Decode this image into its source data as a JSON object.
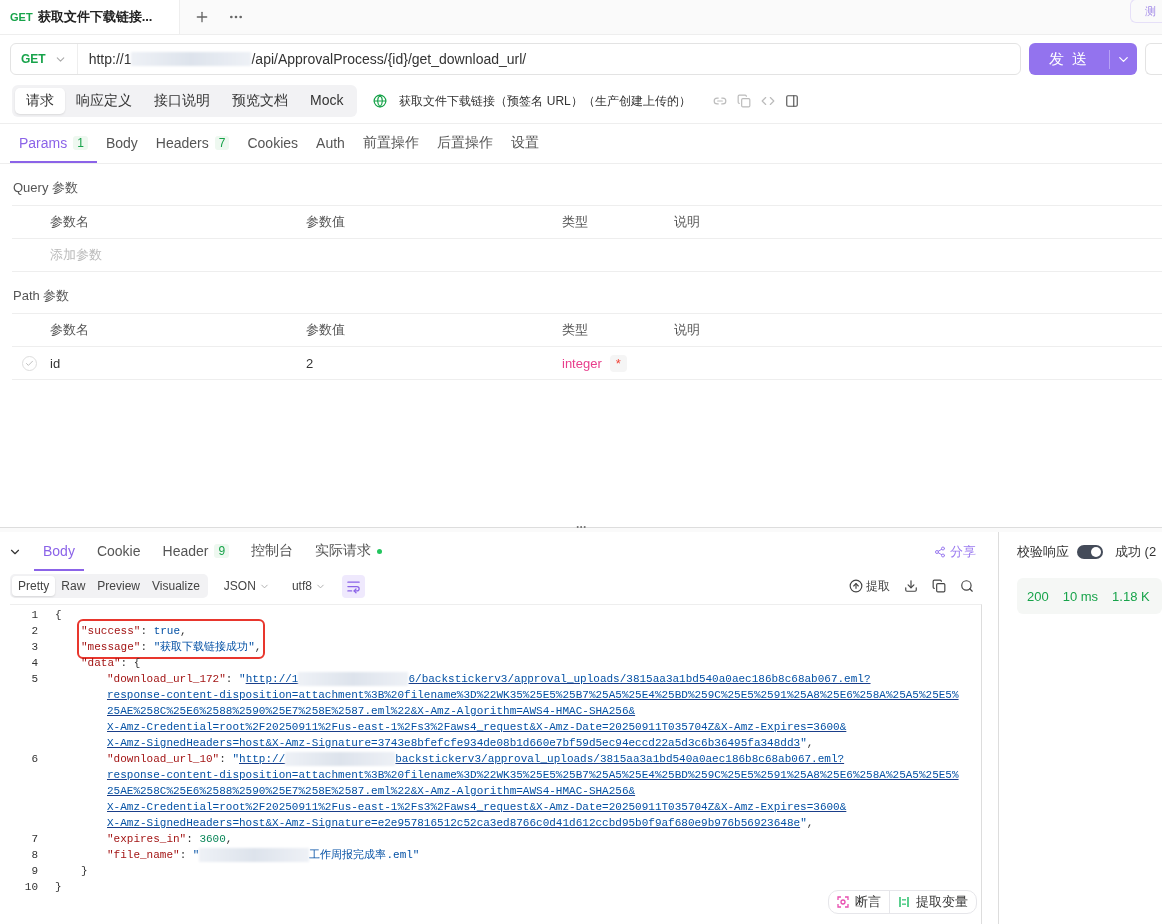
{
  "request_tab": {
    "method": "GET",
    "title": "获取文件下载链接..."
  },
  "corner_tab": "测",
  "url_bar": {
    "method": "GET",
    "url_prefix": "http://1",
    "url_suffix": "/api/ApprovalProcess/{id}/get_download_url/",
    "send": "发 送"
  },
  "request_tabs": [
    {
      "label": "请求",
      "selected": true
    },
    {
      "label": "响应定义",
      "selected": false
    },
    {
      "label": "接口说明",
      "selected": false
    },
    {
      "label": "预览文档",
      "selected": false
    },
    {
      "label": "Mock",
      "selected": false
    }
  ],
  "api_name": "获取文件下载链接（预签名 URL）（生产创建上传的）",
  "param_tabs": [
    {
      "label": "Params",
      "count": "1",
      "selected": true
    },
    {
      "label": "Body",
      "selected": false
    },
    {
      "label": "Headers",
      "count": "7",
      "selected": false
    },
    {
      "label": "Cookies",
      "selected": false
    },
    {
      "label": "Auth",
      "selected": false
    },
    {
      "label": "前置操作",
      "selected": false
    },
    {
      "label": "后置操作",
      "selected": false
    },
    {
      "label": "设置",
      "selected": false
    }
  ],
  "query": {
    "title": "Query 参数",
    "columns": [
      "参数名",
      "参数值",
      "类型",
      "说明"
    ],
    "placeholder": "添加参数"
  },
  "path": {
    "title": "Path 参数",
    "columns": [
      "参数名",
      "参数值",
      "类型",
      "说明"
    ],
    "rows": [
      {
        "checked": true,
        "name": "id",
        "value": "2",
        "type": "integer",
        "required": "*"
      }
    ]
  },
  "response": {
    "tabs": [
      {
        "label": "Body",
        "selected": true
      },
      {
        "label": "Cookie",
        "selected": false
      },
      {
        "label": "Header",
        "count": "9",
        "selected": false
      },
      {
        "label": "控制台",
        "selected": false
      },
      {
        "label": "实际请求",
        "dot": true,
        "selected": false
      }
    ],
    "share": "分享",
    "view_modes": [
      {
        "label": "Pretty",
        "selected": true
      },
      {
        "label": "Raw",
        "selected": false
      },
      {
        "label": "Preview",
        "selected": false
      },
      {
        "label": "Visualize",
        "selected": false
      }
    ],
    "format": "JSON",
    "encoding": "utf8",
    "extract": "提取",
    "lines": [
      {
        "n": "1",
        "tokens": [
          {
            "kind": "open",
            "text": "{"
          }
        ]
      },
      {
        "n": "2",
        "highlighted": true,
        "tokens": [
          {
            "kind": "key",
            "text": "\"success\""
          },
          {
            "kind": "punct",
            "text": ": "
          },
          {
            "kind": "bool",
            "text": "true"
          },
          {
            "kind": "punct",
            "text": ","
          }
        ]
      },
      {
        "n": "3",
        "highlighted": true,
        "tokens": [
          {
            "kind": "key",
            "text": "\"message\""
          },
          {
            "kind": "punct",
            "text": ": "
          },
          {
            "kind": "string",
            "text": "\"获取下载链接成功\""
          },
          {
            "kind": "punct",
            "text": ","
          }
        ]
      },
      {
        "n": "4",
        "highlighted": false,
        "tokens": [
          {
            "kind": "key",
            "text": "\"data\""
          },
          {
            "kind": "punct",
            "text": ": "
          },
          {
            "kind": "open",
            "text": "{"
          }
        ]
      },
      {
        "n": "5",
        "tokens": [
          {
            "kind": "key",
            "text": "\"download_url_172\""
          },
          {
            "kind": "punct",
            "text": ": "
          },
          {
            "kind": "string",
            "text": "\""
          },
          {
            "kind": "link",
            "text": "http://1"
          },
          {
            "kind": "redacted"
          },
          {
            "kind": "link",
            "text": "6/backstickerv3/approval_uploads/3815aa3a1bd540a0aec186b8c68ab067.eml?"
          },
          {
            "kind": "break"
          },
          {
            "kind": "link",
            "text": "response-content-disposition=attachment%3B%20filename%3D%22WK35%25E5%25B7%25A5%25E4%25BD%259C%25E5%2591%25A8%25E6%258A%25A5%25E5%"
          },
          {
            "kind": "break"
          },
          {
            "kind": "link",
            "text": "25AE%258C%25E6%2588%2590%25E7%258E%2587.eml%22&X-Amz-Algorithm=AWS4-HMAC-SHA256&"
          },
          {
            "kind": "break"
          },
          {
            "kind": "link",
            "text": "X-Amz-Credential=root%2F20250911%2Fus-east-1%2Fs3%2Faws4_request&X-Amz-Date=20250911T035704Z&X-Amz-Expires=3600&"
          },
          {
            "kind": "break"
          },
          {
            "kind": "link",
            "text": "X-Amz-SignedHeaders=host&X-Amz-Signature=3743e8bfefcfe934de08b1d660e7bf59d5ec94eccd22a5d3c6b36495fa348dd3"
          },
          {
            "kind": "string",
            "text": "\""
          },
          {
            "kind": "punct",
            "text": ","
          }
        ]
      },
      {
        "n": "6",
        "tokens": [
          {
            "kind": "key",
            "text": "\"download_url_10\""
          },
          {
            "kind": "punct",
            "text": ": "
          },
          {
            "kind": "string",
            "text": "\""
          },
          {
            "kind": "link",
            "text": "http://"
          },
          {
            "kind": "redacted"
          },
          {
            "kind": "link",
            "text": "backstickerv3/approval_uploads/3815aa3a1bd540a0aec186b8c68ab067.eml?"
          },
          {
            "kind": "break"
          },
          {
            "kind": "link",
            "text": "response-content-disposition=attachment%3B%20filename%3D%22WK35%25E5%25B7%25A5%25E4%25BD%259C%25E5%2591%25A8%25E6%258A%25A5%25E5%"
          },
          {
            "kind": "break"
          },
          {
            "kind": "link",
            "text": "25AE%258C%25E6%2588%2590%25E7%258E%2587.eml%22&X-Amz-Algorithm=AWS4-HMAC-SHA256&"
          },
          {
            "kind": "break"
          },
          {
            "kind": "link",
            "text": "X-Amz-Credential=root%2F20250911%2Fus-east-1%2Fs3%2Faws4_request&X-Amz-Date=20250911T035704Z&X-Amz-Expires=3600&"
          },
          {
            "kind": "break"
          },
          {
            "kind": "link",
            "text": "X-Amz-SignedHeaders=host&X-Amz-Signature=e2e957816512c52ca3ed8766c0d41d612ccbd95b0f9af680e9b976b56923648e"
          },
          {
            "kind": "string",
            "text": "\""
          },
          {
            "kind": "punct",
            "text": ","
          }
        ]
      },
      {
        "n": "7",
        "tokens": [
          {
            "kind": "key",
            "text": "\"expires_in\""
          },
          {
            "kind": "punct",
            "text": ": "
          },
          {
            "kind": "number",
            "text": "3600"
          },
          {
            "kind": "punct",
            "text": ","
          }
        ]
      },
      {
        "n": "8",
        "tokens": [
          {
            "kind": "key",
            "text": "\"file_name\""
          },
          {
            "kind": "punct",
            "text": ": "
          },
          {
            "kind": "string",
            "text": "\""
          },
          {
            "kind": "redacted"
          },
          {
            "kind": "string",
            "text": "工作周报完成率.eml\""
          }
        ]
      },
      {
        "n": "9",
        "tokens": [
          {
            "kind": "close",
            "text": "}"
          }
        ]
      },
      {
        "n": "10",
        "tokens": [
          {
            "kind": "close",
            "text": "}"
          }
        ]
      }
    ],
    "actions": [
      "断言",
      "提取变量"
    ]
  },
  "side": {
    "validate_label": "校验响应",
    "validate_on": true,
    "status": "成功 (2",
    "code": "200",
    "time": "10 ms",
    "size": "1.18 K"
  }
}
